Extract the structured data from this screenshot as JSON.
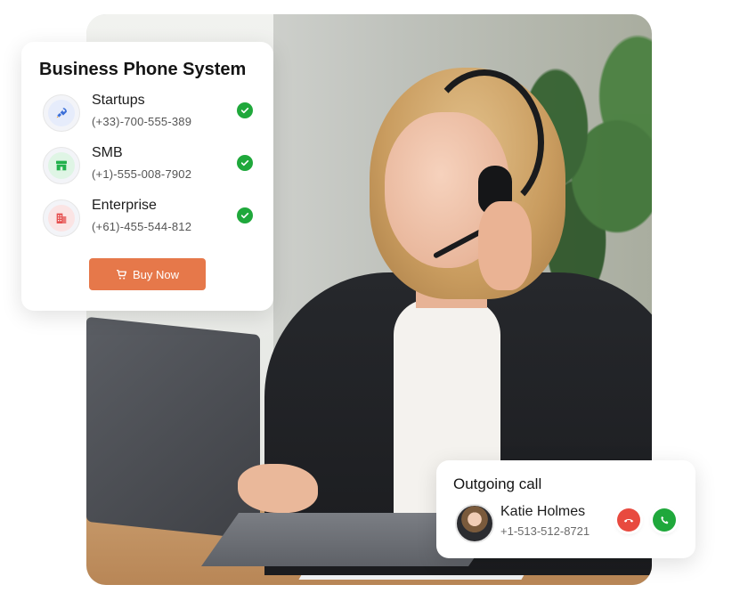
{
  "business_card": {
    "title": "Business Phone System",
    "plans": [
      {
        "name": "Startups",
        "phone": "(+33)-700-555-389",
        "icon": "rocket-icon",
        "icon_color": "#3b6fd8",
        "icon_bg": "#e6ecfb"
      },
      {
        "name": "SMB",
        "phone": "(+1)-555-008-7902",
        "icon": "storefront-icon",
        "icon_color": "#22b14c",
        "icon_bg": "#dff5e5"
      },
      {
        "name": "Enterprise",
        "phone": "(+61)-455-544-812",
        "icon": "building-icon",
        "icon_color": "#e6504f",
        "icon_bg": "#fbe4e4"
      }
    ],
    "buy_button": {
      "label": "Buy Now",
      "icon": "cart-icon",
      "color": "#e6784a"
    }
  },
  "call_card": {
    "title": "Outgoing call",
    "caller_name": "Katie Holmes",
    "caller_phone": "+1-513-512-8721",
    "hangup_icon": "hangup-phone-icon",
    "accept_icon": "phone-icon"
  },
  "colors": {
    "check_green": "#1fa83b",
    "hangup_red": "#e84a3f",
    "accent_orange": "#e6784a"
  }
}
